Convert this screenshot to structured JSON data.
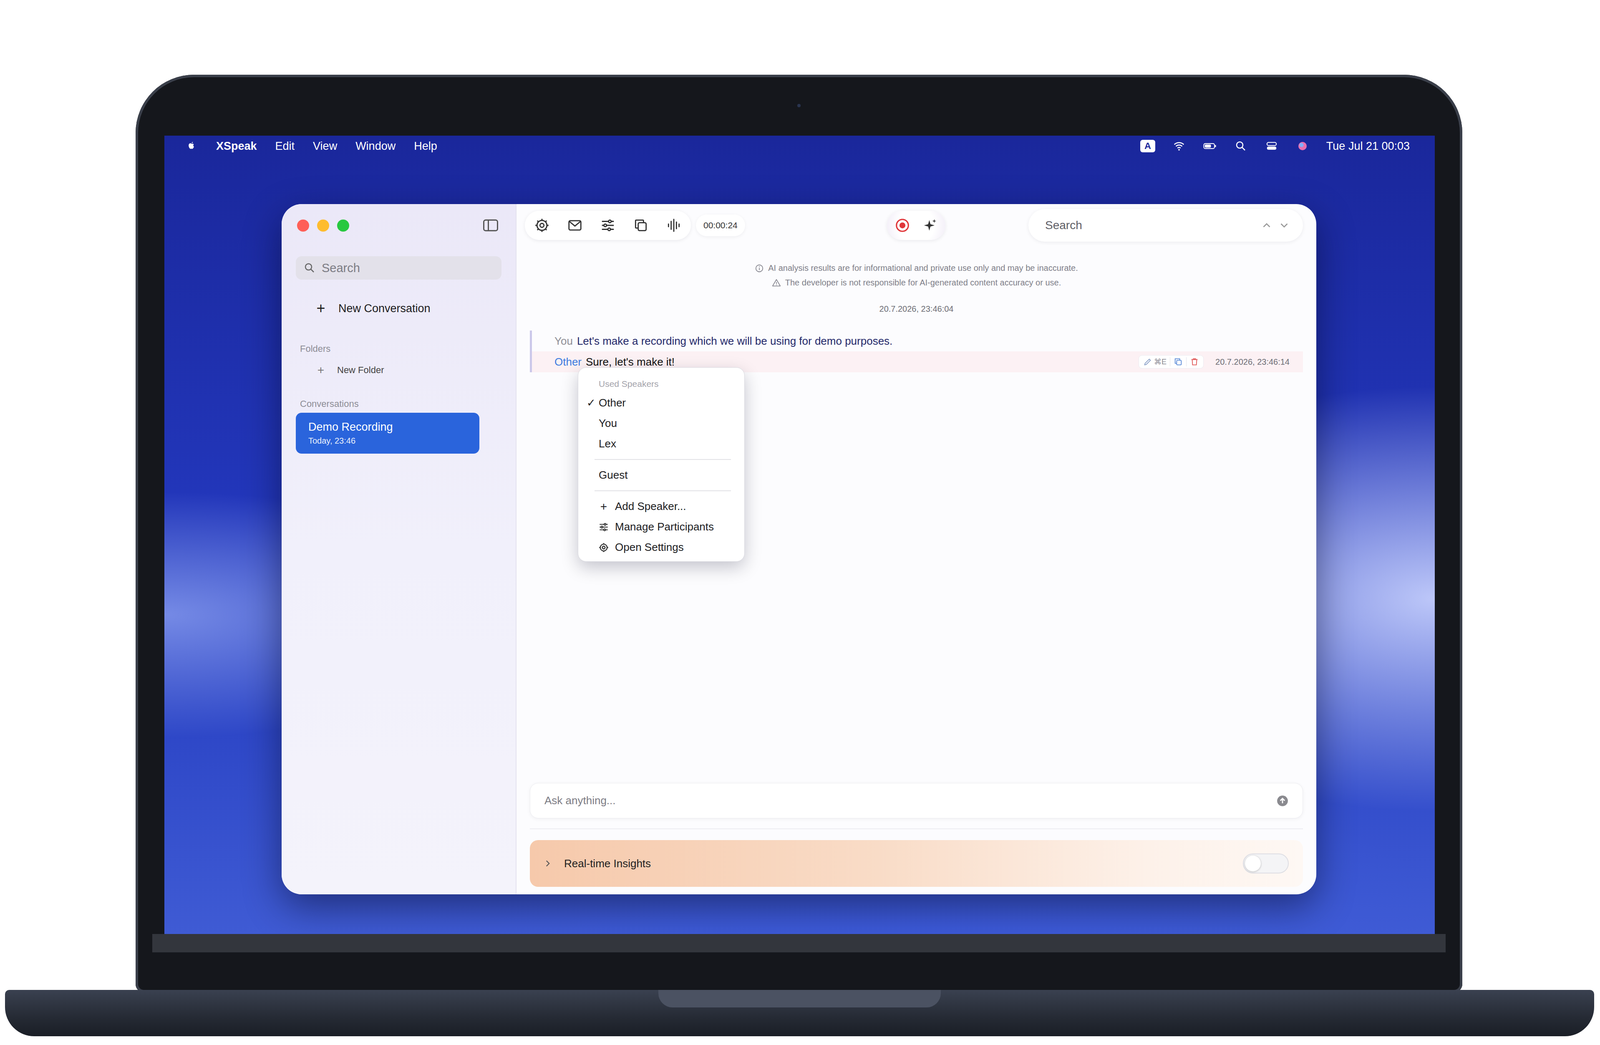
{
  "menubar": {
    "app": "XSpeak",
    "menus": [
      "Edit",
      "View",
      "Window",
      "Help"
    ],
    "input_source": "A",
    "clock": "Tue Jul 21 00:03"
  },
  "sidebar": {
    "search_placeholder": "Search",
    "new_conversation": {
      "icon": "+",
      "label": "New Conversation"
    },
    "folders_heading": "Folders",
    "new_folder": {
      "icon": "+",
      "label": "New Folder"
    },
    "conversations_heading": "Conversations",
    "conversations": [
      {
        "title": "Demo Recording",
        "time": "Today, 23:46",
        "selected": true
      }
    ]
  },
  "toolbar": {
    "timer": "00:00:24",
    "search_placeholder": "Search"
  },
  "disclaimers": [
    "AI analysis results are for informational and private use only and may be inaccurate.",
    "The developer is not responsible for AI-generated content accuracy or use."
  ],
  "date_stamp": "20.7.2026, 23:46:04",
  "messages": [
    {
      "speaker": "You",
      "text": "Let's make a recording which we will be using for demo purposes.",
      "color": "#8e8e96",
      "selected": false,
      "shortcut": "",
      "timestamp": ""
    },
    {
      "speaker": "Other",
      "text": "Sure, let's make it!",
      "color": "#3b7be0",
      "selected": true,
      "shortcut": "⌘E",
      "timestamp": "20.7.2026, 23:46:14"
    }
  ],
  "speaker_menu": {
    "heading": "Used Speakers",
    "check_glyph": "✓",
    "speakers": [
      {
        "label": "Other",
        "checked": true
      },
      {
        "label": "You",
        "checked": false
      },
      {
        "label": "Lex",
        "checked": false
      }
    ],
    "guests": [
      {
        "label": "Guest",
        "checked": false
      }
    ],
    "actions": [
      {
        "kind": "glyph",
        "icon": "+",
        "label": "Add Speaker..."
      },
      {
        "kind": "sliders",
        "icon": "",
        "label": "Manage Participants"
      },
      {
        "kind": "gear",
        "icon": "",
        "label": "Open Settings"
      }
    ]
  },
  "chat_input": {
    "placeholder": "Ask anything..."
  },
  "insights": {
    "label": "Real-time Insights",
    "on": false
  }
}
